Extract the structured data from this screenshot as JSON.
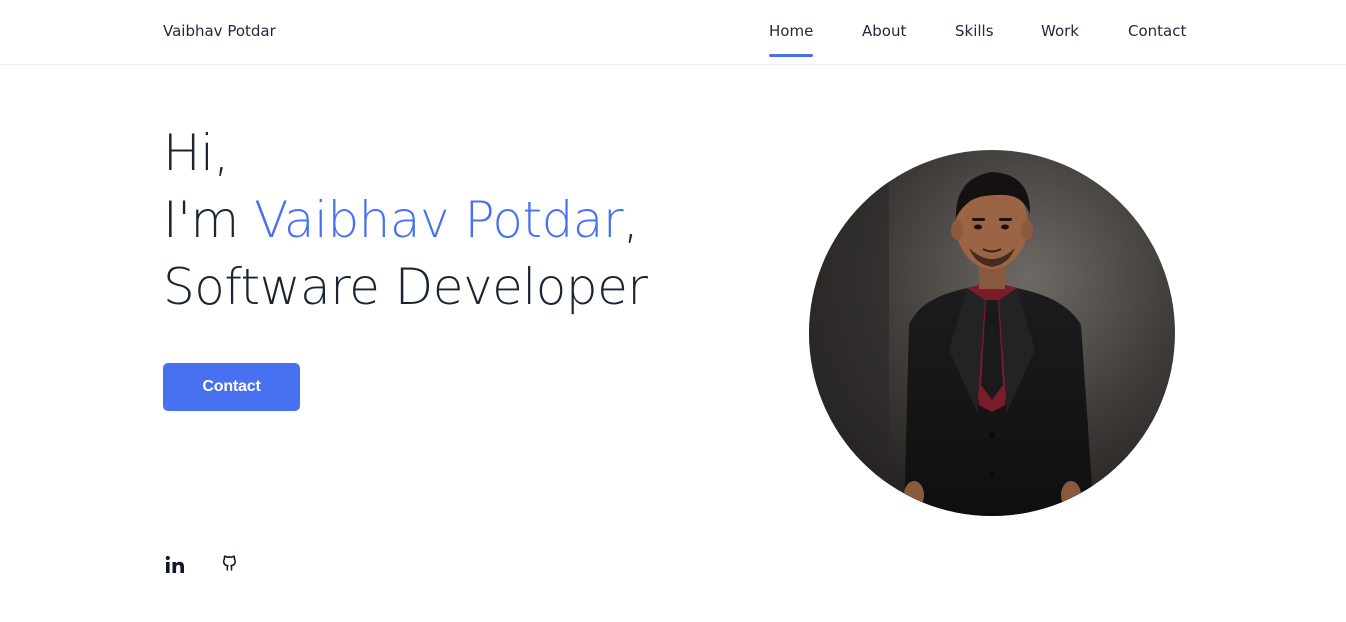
{
  "header": {
    "logo": "Vaibhav Potdar",
    "nav": [
      {
        "label": "Home",
        "active": true
      },
      {
        "label": "About",
        "active": false
      },
      {
        "label": "Skills",
        "active": false
      },
      {
        "label": "Work",
        "active": false
      },
      {
        "label": "Contact",
        "active": false
      }
    ]
  },
  "hero": {
    "line1": "Hi,",
    "line2_prefix": "I'm ",
    "name": "Vaibhav Potdar",
    "line2_suffix": ",",
    "line3": "Software Developer",
    "cta_label": "Contact"
  },
  "social": {
    "icons": [
      "linkedin-icon",
      "github-icon"
    ]
  },
  "colors": {
    "accent": "#4771f0",
    "text": "#1a2433"
  }
}
